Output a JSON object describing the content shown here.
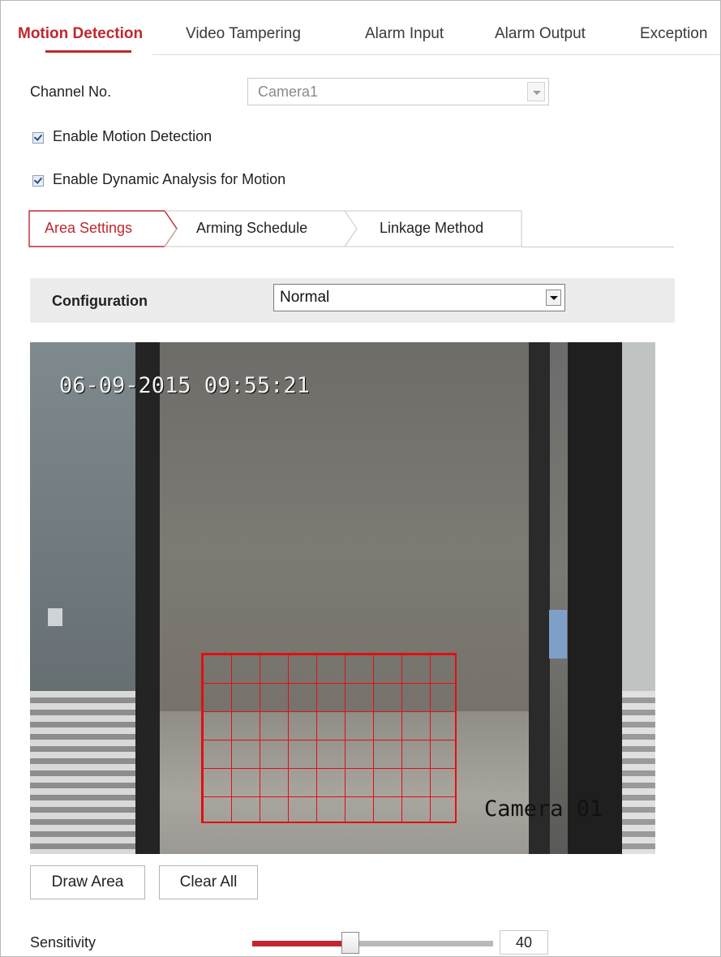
{
  "top_tabs": [
    {
      "label": "Motion Detection",
      "active": true
    },
    {
      "label": "Video Tampering",
      "active": false
    },
    {
      "label": "Alarm Input",
      "active": false
    },
    {
      "label": "Alarm Output",
      "active": false
    },
    {
      "label": "Exception",
      "active": false
    }
  ],
  "channel": {
    "label": "Channel No.",
    "value": "Camera1"
  },
  "checkboxes": {
    "motion": {
      "label": "Enable Motion Detection",
      "checked": true
    },
    "dynamic": {
      "label": "Enable Dynamic Analysis for Motion",
      "checked": true
    }
  },
  "sub_tabs": [
    {
      "label": "Area Settings",
      "active": true
    },
    {
      "label": "Arming Schedule",
      "active": false
    },
    {
      "label": "Linkage Method",
      "active": false
    }
  ],
  "config": {
    "label": "Configuration",
    "value": "Normal"
  },
  "video": {
    "timestamp": "06-09-2015 09:55:21",
    "camera_label": "Camera 01"
  },
  "buttons": {
    "draw_area": "Draw Area",
    "clear_all": "Clear All"
  },
  "sensitivity": {
    "label": "Sensitivity",
    "value": "40",
    "level": 0.4
  },
  "colors": {
    "accent": "#c1272d",
    "grid": "#e01010"
  }
}
